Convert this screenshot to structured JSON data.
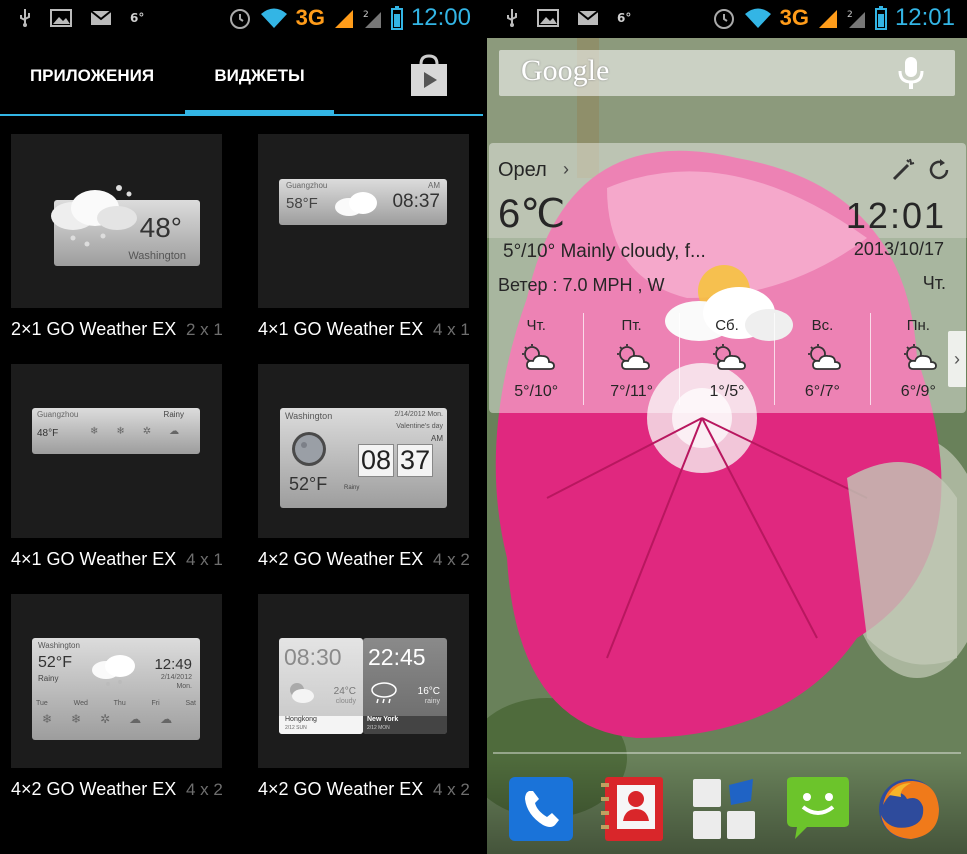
{
  "left": {
    "status": {
      "notif_badge": "6°",
      "network": "3G",
      "time": "12:00"
    },
    "tabs": {
      "apps": "ПРИЛОЖЕНИЯ",
      "widgets": "ВИДЖЕТЫ"
    },
    "widgets": [
      {
        "name": "2×1 GO Weather EX",
        "size": "2 x 1",
        "preview": {
          "temp": "48°",
          "city": "Washington"
        }
      },
      {
        "name": "4×1 GO Weather EX",
        "size": "4 x 1",
        "preview": {
          "city": "Guangzhou",
          "temp": "58°F",
          "time": "08:37",
          "ampm": "AM"
        }
      },
      {
        "name": "4×1 GO Weather EX",
        "size": "4 x 1",
        "preview": {
          "city": "Guangzhou",
          "cond": "Rainy",
          "temp": "48°F"
        }
      },
      {
        "name": "4×2 GO Weather EX",
        "size": "4 x 2",
        "preview": {
          "city": "Washington",
          "date": "2/14/2012 Mon.",
          "note": "Valentine's day",
          "ampm": "AM",
          "hh": "08",
          "mm": "37",
          "temp": "52°F",
          "cond": "Rainy"
        }
      },
      {
        "name": "4×2 GO Weather EX",
        "size": "4 x 2",
        "preview": {
          "city": "Washington",
          "temp": "52°F",
          "cond": "Rainy",
          "time": "12:49",
          "date": "2/14/2012",
          "day": "Mon.",
          "days": [
            "Tue",
            "Wed",
            "Thu",
            "Fri",
            "Sat"
          ]
        }
      },
      {
        "name": "4×2 GO Weather EX",
        "size": "4 x 2",
        "preview": {
          "time1": "08:30",
          "temp1": "24°C",
          "cond1": "cloudy",
          "city1": "Hongkong",
          "date1": "2/12 SUN",
          "time2": "22:45",
          "temp2": "16°C",
          "cond2": "rainy",
          "city2": "New York",
          "date2": "2/12 MON"
        }
      }
    ]
  },
  "right": {
    "status": {
      "notif_badge": "6°",
      "network": "3G",
      "time": "12:01"
    },
    "search": {
      "logo": "Google"
    },
    "weather": {
      "city": "Орел",
      "temp": "6℃",
      "time": "12:01",
      "date": "2013/10/17",
      "condition": "5°/10° Mainly cloudy, f...",
      "wind": "Ветер : 7.0 MPH , W",
      "dow": "Чт.",
      "forecast": [
        {
          "day": "Чт.",
          "range": "5°/10°"
        },
        {
          "day": "Пт.",
          "range": "7°/11°"
        },
        {
          "day": "Сб.",
          "range": "1°/5°"
        },
        {
          "day": "Вс.",
          "range": "6°/7°"
        },
        {
          "day": "Пн.",
          "range": "6°/9°"
        }
      ]
    },
    "dock": [
      "phone-app",
      "contacts-app",
      "app-drawer",
      "messaging-app",
      "firefox-app"
    ]
  },
  "colors": {
    "accent": "#33b5e5",
    "network": "#ff9c1a"
  }
}
